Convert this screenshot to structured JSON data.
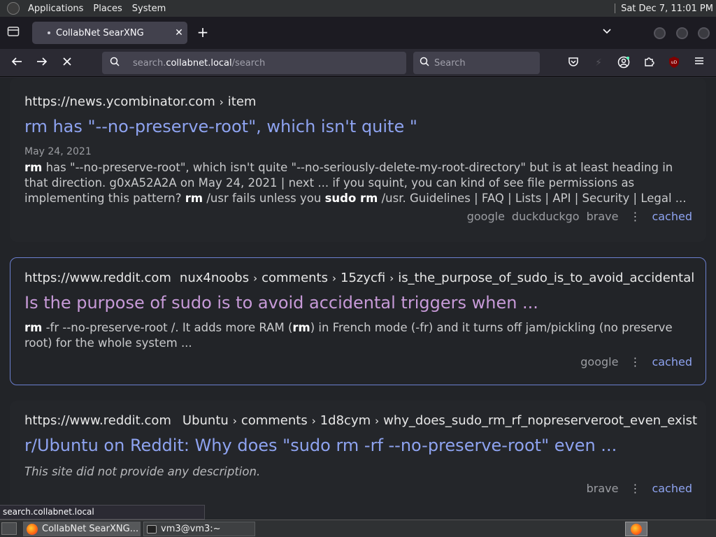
{
  "top_panel": {
    "menus": [
      "Applications",
      "Places",
      "System"
    ],
    "clock": "Sat Dec  7, 11:01 PM"
  },
  "browser": {
    "tab": {
      "title": "CollabNet SearXNG",
      "close_glyph": "✕"
    },
    "new_tab_glyph": "+",
    "url": {
      "prefix": "search.",
      "host": "collabnet.local",
      "path": "/search"
    },
    "search_placeholder": "Search"
  },
  "results": [
    {
      "url_host": "https://news.ycombinator.com",
      "url_path": [
        "item"
      ],
      "title": "rm has \"--no-preserve-root\", which isn't quite \"",
      "date": "May 24, 2021",
      "snippet_parts": [
        {
          "t": "rm",
          "b": true
        },
        {
          "t": " has \"--no-preserve-root\", which isn't quite \"--no-seriously-delete-my-root-directory\" but is at least heading in that direction. g0xA52A2A on May 24, 2021 | next ... if you squint, you can kind of see file permissions as implementing this pattern? ",
          "b": false
        },
        {
          "t": "rm",
          "b": true
        },
        {
          "t": " /usr fails unless you ",
          "b": false
        },
        {
          "t": "sudo rm",
          "b": true
        },
        {
          "t": " /usr. Guidelines | FAQ | Lists | API | Security | Legal ...",
          "b": false
        }
      ],
      "engines": [
        "google",
        "duckduckgo",
        "brave"
      ],
      "cached_label": "cached"
    },
    {
      "url_host": "https://www.reddit.com",
      "url_path": [
        "nux4noobs",
        "comments",
        "15zycfi",
        "is_the_purpose_of_sudo_is_to_avoid_accidental"
      ],
      "title": "Is the purpose of sudo is to avoid accidental triggers when ...",
      "snippet_parts": [
        {
          "t": "rm",
          "b": true
        },
        {
          "t": " -fr --no-preserve-root /. It adds more RAM (",
          "b": false
        },
        {
          "t": "rm",
          "b": true
        },
        {
          "t": ") in French mode (-fr) and it turns off jam/pickling (no preserve root) for the whole system ...",
          "b": false
        }
      ],
      "engines": [
        "google"
      ],
      "cached_label": "cached"
    },
    {
      "url_host": "https://www.reddit.com",
      "url_path": [
        "Ubuntu",
        "comments",
        "1d8cym",
        "why_does_sudo_rm_rf_nopreserveroot_even_exist"
      ],
      "title": "r/Ubuntu on Reddit: Why does \"sudo rm -rf --no-preserve-root\" even ...",
      "no_description": "This site did not provide any description.",
      "engines": [
        "brave"
      ],
      "cached_label": "cached"
    }
  ],
  "status_url": "search.collabnet.local",
  "taskbar": {
    "tasks": [
      "CollabNet SearXNG...",
      "vm3@vm3:~"
    ]
  }
}
